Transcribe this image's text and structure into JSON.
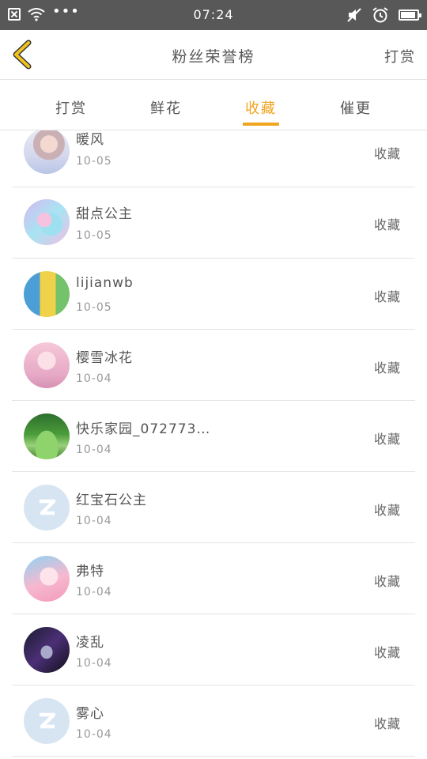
{
  "status_bar": {
    "time": "07:24",
    "left_icons": [
      "close-box-icon",
      "wifi-icon",
      "more-dots-icon"
    ],
    "right_icons": [
      "mute-icon",
      "alarm-icon",
      "battery-icon"
    ]
  },
  "header": {
    "title": "粉丝荣誉榜",
    "action": "打赏"
  },
  "tabs": [
    {
      "label": "打赏",
      "active": false
    },
    {
      "label": "鲜花",
      "active": false
    },
    {
      "label": "收藏",
      "active": true
    },
    {
      "label": "催更",
      "active": false
    }
  ],
  "colors": {
    "accent": "#f0a51f",
    "status_bar": "#585858",
    "back_arrow": "#f0c21f"
  },
  "list": {
    "items": [
      {
        "name": "暖风",
        "date": "10-05",
        "action": "收藏"
      },
      {
        "name": "甜点公主",
        "date": "10-05",
        "action": "收藏"
      },
      {
        "name": "lijianwb",
        "date": "10-05",
        "action": "收藏"
      },
      {
        "name": "樱雪冰花",
        "date": "10-04",
        "action": "收藏"
      },
      {
        "name": "快乐家园_072773…",
        "date": "10-04",
        "action": "收藏"
      },
      {
        "name": "红宝石公主",
        "date": "10-04",
        "action": "收藏"
      },
      {
        "name": "弗特",
        "date": "10-04",
        "action": "收藏"
      },
      {
        "name": "凌乱",
        "date": "10-04",
        "action": "收藏"
      },
      {
        "name": "雾心",
        "date": "10-04",
        "action": "收藏"
      }
    ]
  }
}
